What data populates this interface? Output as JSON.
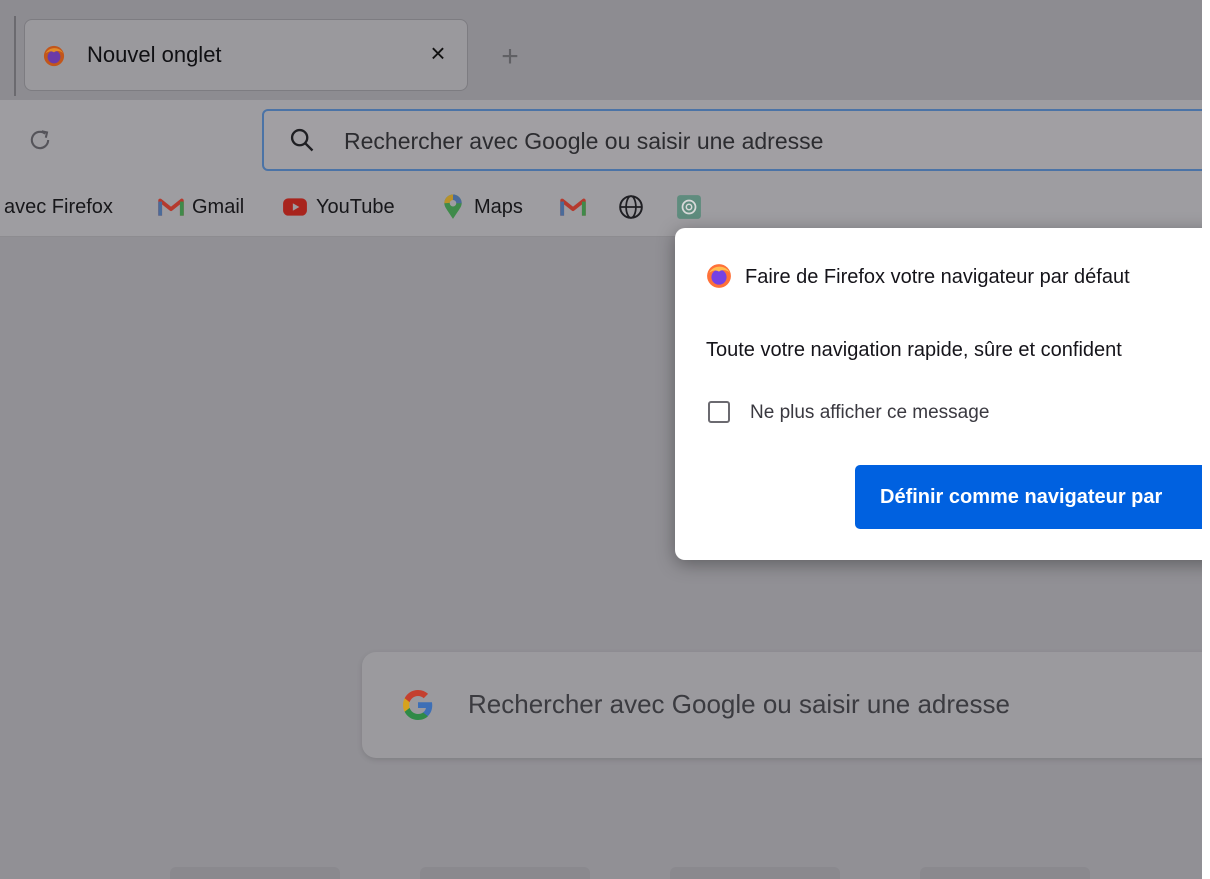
{
  "tab": {
    "title": "Nouvel onglet",
    "close_glyph": "×",
    "favicon": "firefox-icon"
  },
  "toolbar": {
    "new_tab_glyph": "+",
    "reload_icon": "reload-icon",
    "urlbar_placeholder": "Rechercher avec Google ou saisir une adresse"
  },
  "bookmarks": [
    {
      "label": "avec Firefox",
      "icon": ""
    },
    {
      "label": "Gmail",
      "icon": "gmail-icon"
    },
    {
      "label": "YouTube",
      "icon": "youtube-icon"
    },
    {
      "label": "Maps",
      "icon": "maps-icon"
    },
    {
      "label": "",
      "icon": "gmail-icon"
    },
    {
      "label": "",
      "icon": "globe-icon"
    },
    {
      "label": "",
      "icon": "chatgpt-icon"
    }
  ],
  "newtab": {
    "search_placeholder": "Rechercher avec Google ou saisir une adresse"
  },
  "dialog": {
    "heading": "Faire de Firefox votre navigateur par défaut",
    "body": "Toute votre navigation rapide, sûre et confident",
    "checkbox_label": "Ne plus afficher ce message",
    "checkbox_checked": false,
    "primary_button": "Définir comme navigateur par"
  },
  "colors": {
    "accent": "#0061e0",
    "overlay": "#919095"
  }
}
